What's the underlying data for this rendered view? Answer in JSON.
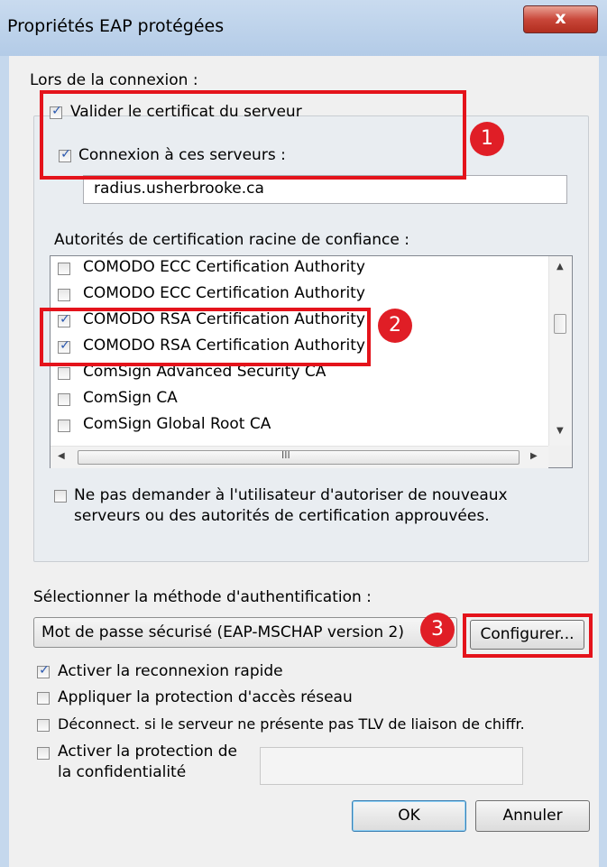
{
  "window": {
    "title": "Propriétés EAP protégées",
    "close_symbol": "x"
  },
  "connection": {
    "group_label": "Lors de la connexion :",
    "validate_cert": {
      "label": "Valider le certificat du serveur",
      "checked": true
    },
    "connect_servers": {
      "label": "Connexion à ces serveurs :",
      "checked": true
    },
    "servers_value": "radius.usherbrooke.ca"
  },
  "root_ca": {
    "label": "Autorités de certification racine de confiance :",
    "items": [
      {
        "label": "COMODO ECC Certification Authority",
        "checked": false
      },
      {
        "label": "COMODO ECC Certification Authority",
        "checked": false
      },
      {
        "label": "COMODO RSA Certification Authority",
        "checked": true
      },
      {
        "label": "COMODO RSA Certification Authority",
        "checked": true
      },
      {
        "label": "ComSign Advanced Security CA",
        "checked": false
      },
      {
        "label": "ComSign CA",
        "checked": false
      },
      {
        "label": "ComSign Global Root CA",
        "checked": false
      }
    ],
    "h_thumb_grip": "III"
  },
  "no_prompt": {
    "line1": "Ne pas demander à l'utilisateur d'autoriser de nouveaux",
    "line2": "serveurs ou des autorités de certification approuvées.",
    "checked": false
  },
  "auth": {
    "label": "Sélectionner la méthode d'authentification :",
    "method_value": "Mot de passe sécurisé (EAP-MSCHAP version 2)",
    "configure_label": "Configurer..."
  },
  "options": {
    "fast_reconnect": {
      "label": "Activer la reconnexion rapide",
      "checked": true
    },
    "nap": {
      "label": "Appliquer la protection d'accès réseau",
      "checked": false
    },
    "disconnect_tlv": {
      "label": "Déconnect. si le serveur ne présente pas TLV de liaison de chiffr.",
      "checked": false
    },
    "privacy_line1": "Activer la protection de",
    "privacy_line2": "la confidentialité",
    "privacy_checked": false
  },
  "buttons": {
    "ok": "OK",
    "cancel": "Annuler"
  },
  "annotations": {
    "badge1": "1",
    "badge2": "2",
    "badge3": "3"
  },
  "colors": {
    "annotation_red": "#e4131b",
    "check_blue": "#2a58b0"
  }
}
